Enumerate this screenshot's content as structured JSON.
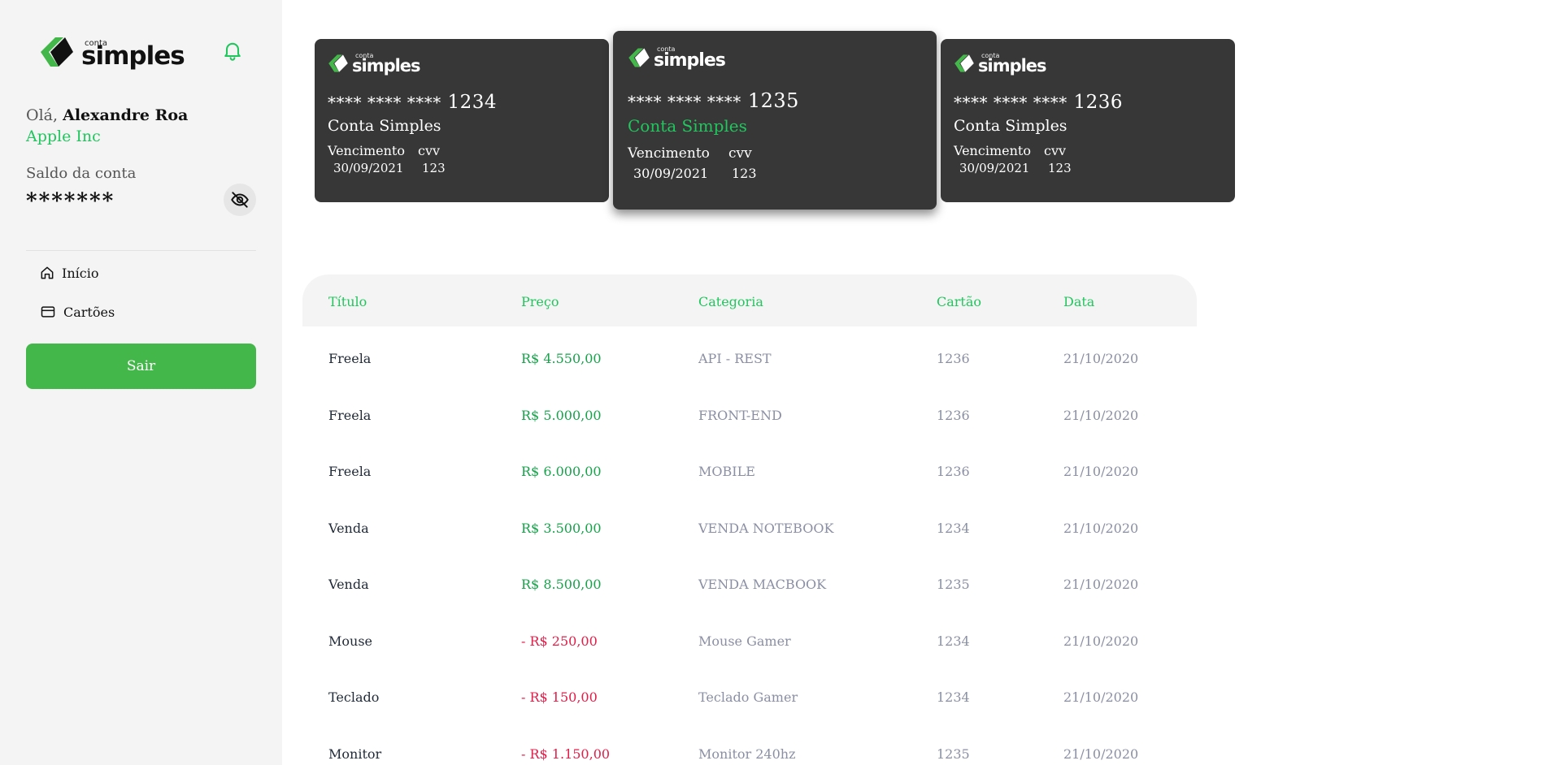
{
  "sidebar": {
    "logo": {
      "small": "conta",
      "big": "simples"
    },
    "greeting_prefix": "Olá,",
    "user_name": "Alexandre Roa",
    "company": "Apple Inc",
    "balance_label": "Saldo da conta",
    "balance_value": "*******",
    "nav": [
      {
        "label": "Início",
        "icon": "home-icon"
      },
      {
        "label": "Cartões",
        "icon": "credit-card-icon"
      }
    ],
    "logout_label": "Sair",
    "accent_color": "#44b74a"
  },
  "cards": [
    {
      "logo_small": "conta",
      "logo_big": "simples",
      "mask": "**** **** ****",
      "last4": "1234",
      "name": "Conta Simples",
      "exp_label": "Vencimento",
      "exp": "30/09/2021",
      "cvv_label": "cvv",
      "cvv": "123",
      "selected": false
    },
    {
      "logo_small": "conta",
      "logo_big": "simples",
      "mask": "**** **** ****",
      "last4": "1235",
      "name": "Conta Simples",
      "exp_label": "Vencimento",
      "exp": "30/09/2021",
      "cvv_label": "cvv",
      "cvv": "123",
      "selected": true
    },
    {
      "logo_small": "conta",
      "logo_big": "simples",
      "mask": "**** **** ****",
      "last4": "1236",
      "name": "Conta Simples",
      "exp_label": "Vencimento",
      "exp": "30/09/2021",
      "cvv_label": "cvv",
      "cvv": "123",
      "selected": false
    }
  ],
  "table": {
    "headers": [
      "Título",
      "Preço",
      "Categoria",
      "Cartão",
      "Data"
    ],
    "rows": [
      {
        "title": "Freela",
        "price": "R$ 4.550,00",
        "category": "API - REST",
        "card": "1236",
        "date": "21/10/2020"
      },
      {
        "title": "Freela",
        "price": "R$ 5.000,00",
        "category": "FRONT-END",
        "card": "1236",
        "date": "21/10/2020"
      },
      {
        "title": "Freela",
        "price": "R$ 6.000,00",
        "category": "MOBILE",
        "card": "1236",
        "date": "21/10/2020"
      },
      {
        "title": "Venda",
        "price": "R$ 3.500,00",
        "category": "VENDA NOTEBOOK",
        "card": "1234",
        "date": "21/10/2020"
      },
      {
        "title": "Venda",
        "price": "R$ 8.500,00",
        "category": "VENDA MACBOOK",
        "card": "1235",
        "date": "21/10/2020"
      },
      {
        "title": "Mouse",
        "price": "- R$ 250,00",
        "category": "Mouse Gamer",
        "card": "1234",
        "date": "21/10/2020"
      },
      {
        "title": "Teclado",
        "price": "- R$ 150,00",
        "category": "Teclado Gamer",
        "card": "1234",
        "date": "21/10/2020"
      },
      {
        "title": "Monitor",
        "price": "- R$ 1.150,00",
        "category": "Monitor 240hz",
        "card": "1235",
        "date": "21/10/2020"
      }
    ]
  }
}
